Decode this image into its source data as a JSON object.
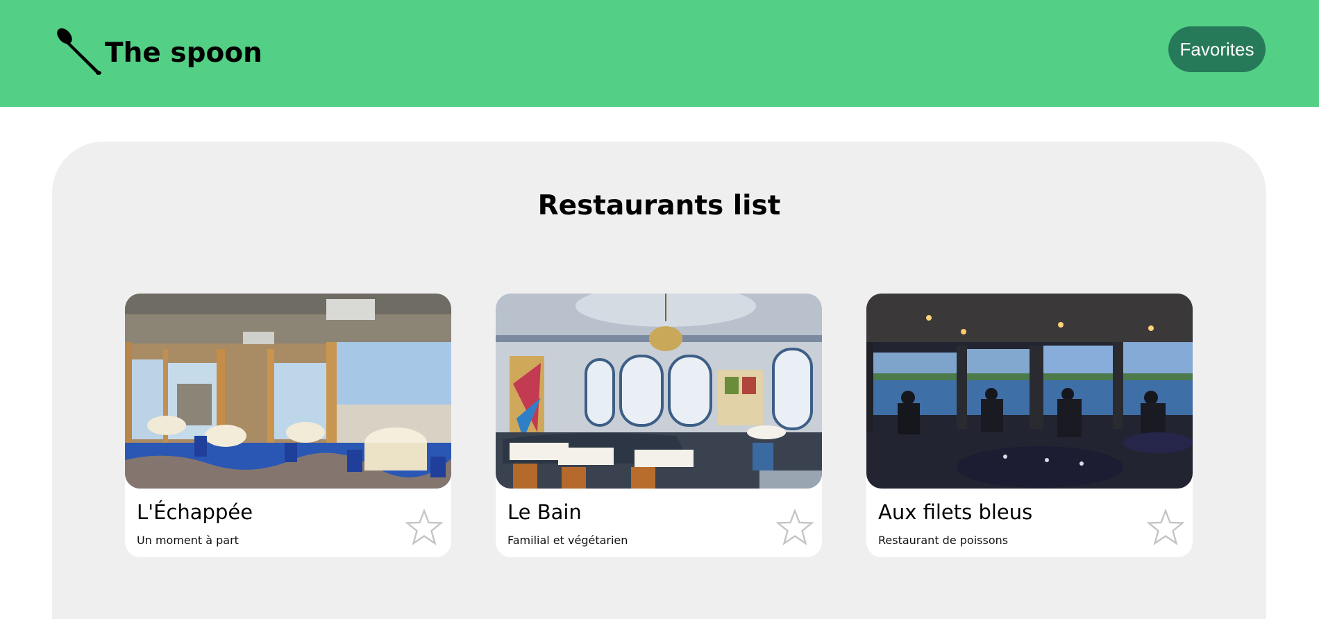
{
  "header": {
    "brand": "The spoon",
    "favorites_label": "Favorites",
    "logo_icon": "spoon-icon",
    "bg_color": "#53d086",
    "button_color": "#277a59"
  },
  "main": {
    "title": "Restaurants list",
    "restaurants": [
      {
        "name": "L'Échappée",
        "description": "Un moment à part",
        "favorite": false,
        "star_icon": "star-outline-icon"
      },
      {
        "name": "Le Bain",
        "description": "Familial et végétarien",
        "favorite": false,
        "star_icon": "star-outline-icon"
      },
      {
        "name": "Aux filets bleus",
        "description": "Restaurant de poissons",
        "favorite": false,
        "star_icon": "star-outline-icon"
      }
    ]
  }
}
